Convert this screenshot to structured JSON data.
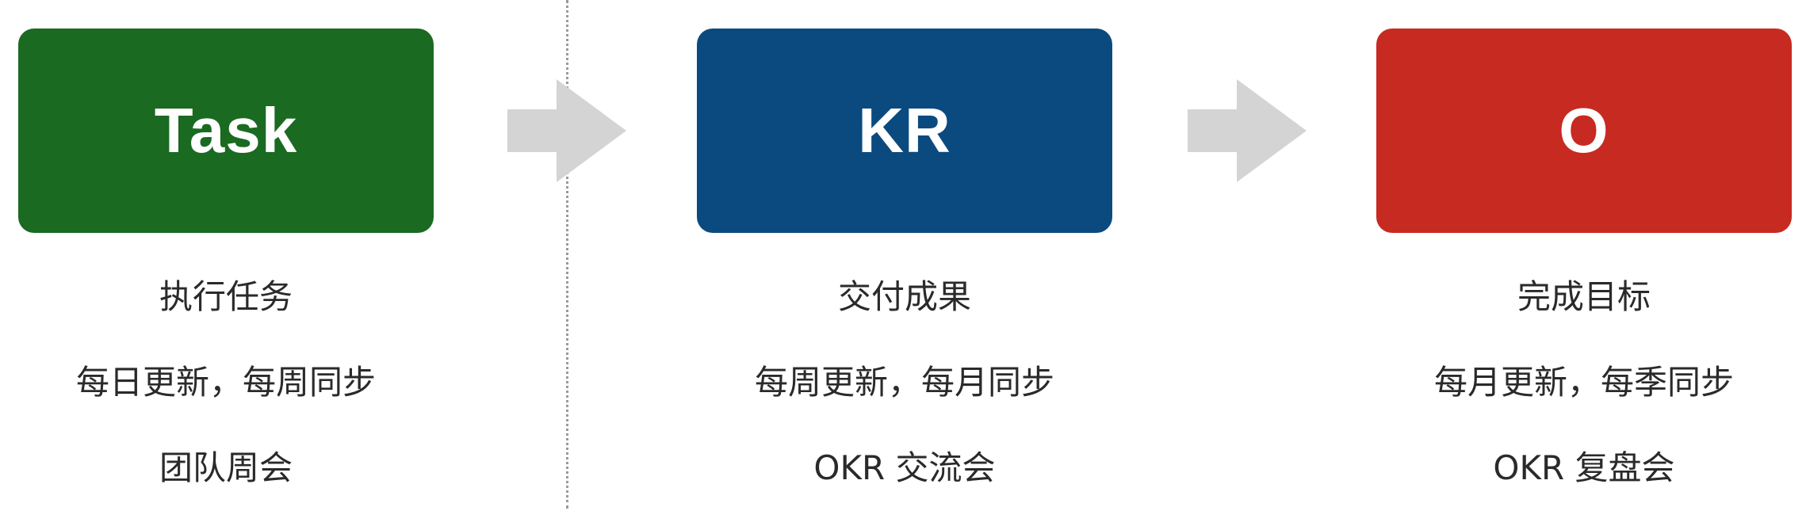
{
  "colors": {
    "task": "#1a6a22",
    "kr": "#0b4a7f",
    "o": "#c72a21",
    "arrow": "#d4d4d4",
    "divider": "#9a9a9a"
  },
  "stages": [
    {
      "title": "Task",
      "lines": [
        "执行任务",
        "每日更新，每周同步",
        "团队周会"
      ]
    },
    {
      "title": "KR",
      "lines": [
        "交付成果",
        "每周更新，每月同步",
        "OKR 交流会"
      ]
    },
    {
      "title": "O",
      "lines": [
        "完成目标",
        "每月更新，每季同步",
        "OKR 复盘会"
      ]
    }
  ],
  "icons": {
    "arrow1": "arrow-right-icon",
    "arrow2": "arrow-right-icon"
  }
}
